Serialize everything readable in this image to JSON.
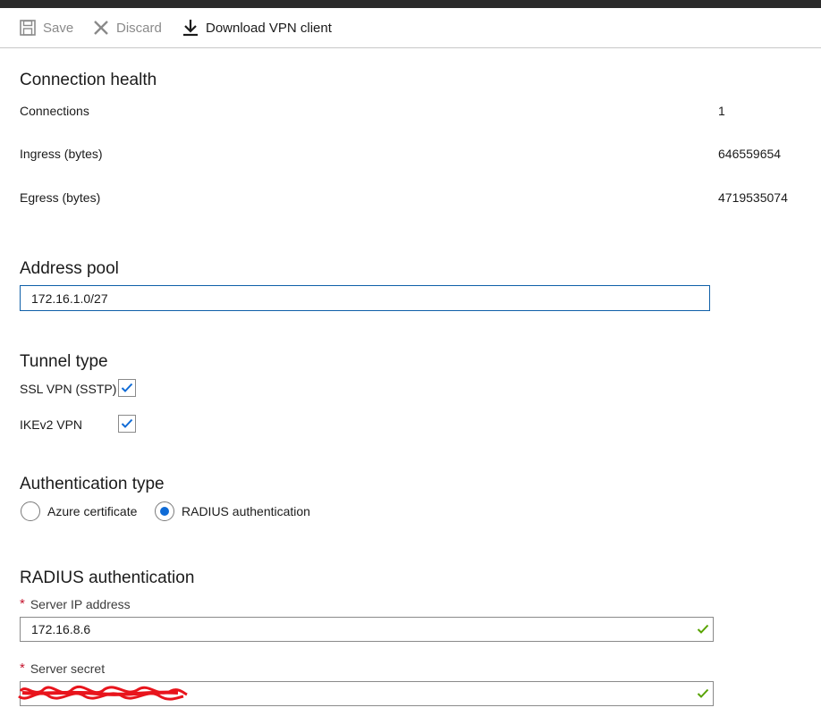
{
  "toolbar": {
    "save_label": "Save",
    "discard_label": "Discard",
    "download_label": "Download VPN client"
  },
  "connection_health": {
    "title": "Connection health",
    "rows": [
      {
        "label": "Connections",
        "value": "1"
      },
      {
        "label": "Ingress (bytes)",
        "value": "646559654"
      },
      {
        "label": "Egress (bytes)",
        "value": "4719535074"
      }
    ]
  },
  "address_pool": {
    "title": "Address pool",
    "value": "172.16.1.0/27"
  },
  "tunnel_type": {
    "title": "Tunnel type",
    "options": [
      {
        "label": "SSL VPN (SSTP)",
        "checked": true
      },
      {
        "label": "IKEv2 VPN",
        "checked": true
      }
    ]
  },
  "authentication_type": {
    "title": "Authentication type",
    "options": [
      {
        "label": "Azure certificate",
        "selected": false
      },
      {
        "label": "RADIUS authentication",
        "selected": true
      }
    ]
  },
  "radius": {
    "title": "RADIUS authentication",
    "server_ip_label": "Server IP address",
    "server_ip_value": "172.16.8.6",
    "server_secret_label": "Server secret",
    "required_marker": "*"
  },
  "colors": {
    "accent": "#0f6bd6",
    "valid": "#57a300",
    "required": "#c5152e",
    "redaction": "#e8141c"
  },
  "icons": [
    "save-icon",
    "discard-icon",
    "download-icon",
    "checkmark-icon",
    "valid-check-icon"
  ]
}
